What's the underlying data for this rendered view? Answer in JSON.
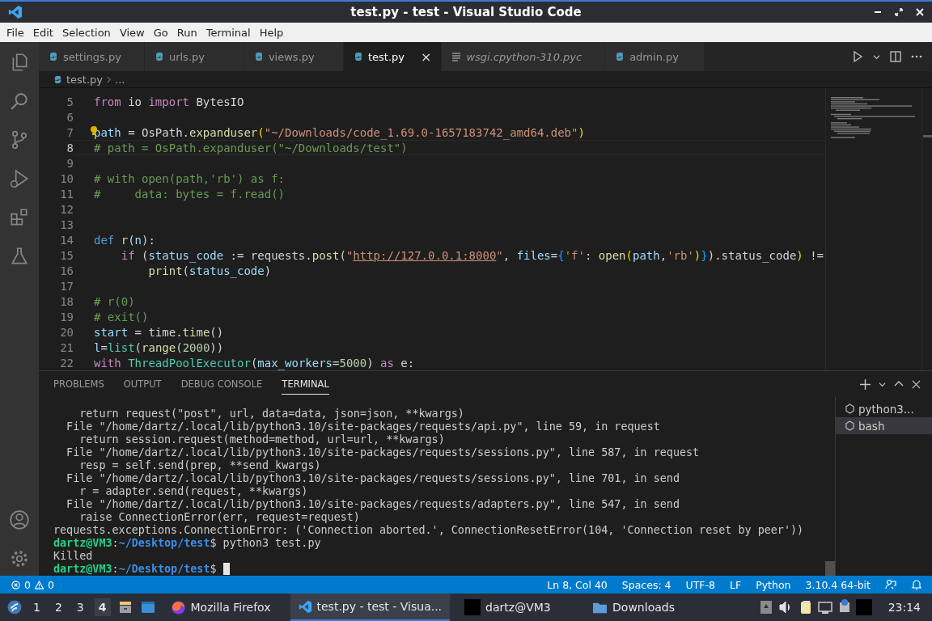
{
  "window": {
    "title": "test.py - test - Visual Studio Code"
  },
  "menu": [
    "File",
    "Edit",
    "Selection",
    "View",
    "Go",
    "Run",
    "Terminal",
    "Help"
  ],
  "tabs": [
    {
      "label": "settings.py",
      "kind": "python",
      "selected": false,
      "preview": false
    },
    {
      "label": "urls.py",
      "kind": "python",
      "selected": false,
      "preview": false
    },
    {
      "label": "views.py",
      "kind": "python",
      "selected": false,
      "preview": false
    },
    {
      "label": "test.py",
      "kind": "python",
      "selected": true,
      "preview": false,
      "close": "×"
    },
    {
      "label": "wsgi.cpython-310.pyc",
      "kind": "binary",
      "selected": false,
      "preview": true
    },
    {
      "label": "admin.py",
      "kind": "python",
      "selected": false,
      "preview": false
    }
  ],
  "breadcrumb": {
    "file": "test.py",
    "rest": "..."
  },
  "code": [
    {
      "number": "5",
      "current": false,
      "tokens": [
        {
          "kind": "kw",
          "text": "from"
        },
        {
          "kind": "plain",
          "text": " io "
        },
        {
          "kind": "kw",
          "text": "import"
        },
        {
          "kind": "plain",
          "text": " BytesIO"
        }
      ]
    },
    {
      "number": "6",
      "current": false
    },
    {
      "number": "7",
      "current": false,
      "bulb": true,
      "tokens": [
        {
          "kind": "var",
          "text": "path"
        },
        {
          "kind": "plain",
          "text": " = OsPath."
        },
        {
          "kind": "fn",
          "text": "expanduser"
        },
        {
          "kind": "brace",
          "text": "("
        },
        {
          "kind": "str",
          "text": "\"~/Downloads/code_1.69.0-1657183742_amd64.deb\""
        },
        {
          "kind": "brace",
          "text": ")"
        }
      ]
    },
    {
      "number": "8",
      "current": true,
      "tokens": [
        {
          "kind": "com",
          "text": "# path = OsPath.expanduser(\"~/Downloads/test\")"
        }
      ]
    },
    {
      "number": "9",
      "current": false
    },
    {
      "number": "10",
      "current": false,
      "tokens": [
        {
          "kind": "com",
          "text": "# with open(path,'rb') as f:"
        }
      ]
    },
    {
      "number": "11",
      "current": false,
      "tokens": [
        {
          "kind": "com",
          "text": "#     data: bytes = f.read()"
        }
      ]
    },
    {
      "number": "12",
      "current": false
    },
    {
      "number": "13",
      "current": false
    },
    {
      "number": "14",
      "current": false,
      "tokens": [
        {
          "kind": "def",
          "text": "def "
        },
        {
          "kind": "fn",
          "text": "r"
        },
        {
          "kind": "plain",
          "text": "("
        },
        {
          "kind": "var",
          "text": "n"
        },
        {
          "kind": "plain",
          "text": "):"
        }
      ]
    },
    {
      "number": "15",
      "current": false,
      "tokens": [
        {
          "kind": "kw",
          "text": "    if"
        },
        {
          "kind": "plain",
          "text": " ("
        },
        {
          "kind": "var",
          "text": "status_code"
        },
        {
          "kind": "plain",
          "text": " := requests."
        },
        {
          "kind": "fn",
          "text": "post"
        },
        {
          "kind": "plain",
          "text": "("
        },
        {
          "kind": "str",
          "text": "\""
        },
        {
          "kind": "link",
          "text": "http://127.0.0.1:8000"
        },
        {
          "kind": "str",
          "text": "\""
        },
        {
          "kind": "plain",
          "text": ", "
        },
        {
          "kind": "var",
          "text": "files"
        },
        {
          "kind": "plain",
          "text": "="
        },
        {
          "kind": "brace2",
          "text": "{"
        },
        {
          "kind": "str",
          "text": "'f'"
        },
        {
          "kind": "plain",
          "text": ": "
        },
        {
          "kind": "fn",
          "text": "open"
        },
        {
          "kind": "brace",
          "text": "("
        },
        {
          "kind": "var",
          "text": "path"
        },
        {
          "kind": "plain",
          "text": ","
        },
        {
          "kind": "str",
          "text": "'rb'"
        },
        {
          "kind": "brace",
          "text": ")"
        },
        {
          "kind": "brace2",
          "text": "}"
        },
        {
          "kind": "plain",
          "text": ").status_code"
        },
        {
          "kind": "brace",
          "text": ")"
        },
        {
          "kind": "plain",
          "text": " !="
        }
      ]
    },
    {
      "number": "16",
      "current": false,
      "tokens": [
        {
          "kind": "fn",
          "text": "        print"
        },
        {
          "kind": "plain",
          "text": "("
        },
        {
          "kind": "var",
          "text": "status_code"
        },
        {
          "kind": "plain",
          "text": ")"
        }
      ]
    },
    {
      "number": "17",
      "current": false
    },
    {
      "number": "18",
      "current": false,
      "tokens": [
        {
          "kind": "com",
          "text": "# r(0)"
        }
      ]
    },
    {
      "number": "19",
      "current": false,
      "tokens": [
        {
          "kind": "com",
          "text": "# exit()"
        }
      ]
    },
    {
      "number": "20",
      "current": false,
      "tokens": [
        {
          "kind": "var",
          "text": "start"
        },
        {
          "kind": "plain",
          "text": " = time."
        },
        {
          "kind": "fn",
          "text": "time"
        },
        {
          "kind": "plain",
          "text": "()"
        }
      ]
    },
    {
      "number": "21",
      "current": false,
      "tokens": [
        {
          "kind": "var",
          "text": "l"
        },
        {
          "kind": "plain",
          "text": "="
        },
        {
          "kind": "cls",
          "text": "list"
        },
        {
          "kind": "plain",
          "text": "("
        },
        {
          "kind": "fn",
          "text": "range"
        },
        {
          "kind": "plain",
          "text": "("
        },
        {
          "kind": "num",
          "text": "2000"
        },
        {
          "kind": "plain",
          "text": "))"
        }
      ]
    },
    {
      "number": "22",
      "current": false,
      "tokens": [
        {
          "kind": "kw",
          "text": "with "
        },
        {
          "kind": "cls",
          "text": "ThreadPoolExecutor"
        },
        {
          "kind": "plain",
          "text": "("
        },
        {
          "kind": "var",
          "text": "max_workers"
        },
        {
          "kind": "plain",
          "text": "="
        },
        {
          "kind": "num",
          "text": "5000"
        },
        {
          "kind": "plain",
          "text": ") "
        },
        {
          "kind": "kw",
          "text": "as"
        },
        {
          "kind": "plain",
          "text": " e:"
        }
      ]
    }
  ],
  "panel_tabs": [
    {
      "label": "PROBLEMS",
      "selected": false
    },
    {
      "label": "OUTPUT",
      "selected": false
    },
    {
      "label": "DEBUG CONSOLE",
      "selected": false
    },
    {
      "label": "TERMINAL",
      "selected": true
    }
  ],
  "terminal": [
    {
      "kind": "plain",
      "text": "    return request(\"post\", url, data=data, json=json, **kwargs)"
    },
    {
      "kind": "plain",
      "text": "  File \"/home/dartz/.local/lib/python3.10/site-packages/requests/api.py\", line 59, in request"
    },
    {
      "kind": "plain",
      "text": "    return session.request(method=method, url=url, **kwargs)"
    },
    {
      "kind": "plain",
      "text": "  File \"/home/dartz/.local/lib/python3.10/site-packages/requests/sessions.py\", line 587, in request"
    },
    {
      "kind": "plain",
      "text": "    resp = self.send(prep, **send_kwargs)"
    },
    {
      "kind": "plain",
      "text": "  File \"/home/dartz/.local/lib/python3.10/site-packages/requests/sessions.py\", line 701, in send"
    },
    {
      "kind": "plain",
      "text": "    r = adapter.send(request, **kwargs)"
    },
    {
      "kind": "plain",
      "text": "  File \"/home/dartz/.local/lib/python3.10/site-packages/requests/adapters.py\", line 547, in send"
    },
    {
      "kind": "plain",
      "text": "    raise ConnectionError(err, request=request)"
    },
    {
      "kind": "plain",
      "text": "requests.exceptions.ConnectionError: ('Connection aborted.', ConnectionResetError(104, 'Connection reset by peer'))"
    },
    {
      "kind": "prompt",
      "user": "dartz@VM3",
      "sep": ":",
      "path": "~/Desktop/test",
      "command": "$ python3 test.py"
    },
    {
      "kind": "plain",
      "text": "Killed"
    },
    {
      "kind": "prompt",
      "user": "dartz@VM3",
      "sep": ":",
      "path": "~/Desktop/test",
      "command": "$ ",
      "cursor": true
    }
  ],
  "terminal_list": [
    {
      "label": "python3...",
      "selected": false
    },
    {
      "label": "bash",
      "selected": true
    }
  ],
  "status_bar": {
    "errors": "0",
    "warnings": "0",
    "items": [
      "Ln 8, Col 40",
      "Spaces: 4",
      "UTF-8",
      "LF",
      "Python",
      "3.10.4 64-bit"
    ]
  },
  "taskbar": {
    "workspaces": [
      {
        "label": "1",
        "selected": false
      },
      {
        "label": "2",
        "selected": false
      },
      {
        "label": "3",
        "selected": false
      },
      {
        "label": "4",
        "selected": true
      }
    ],
    "windows": [
      {
        "label": "Mozilla Firefox",
        "kind": "browser",
        "selected": false
      },
      {
        "label": "test.py - test - Visua...",
        "kind": "editor",
        "selected": true
      },
      {
        "label": "dartz@VM3",
        "kind": "terminal",
        "selected": false
      },
      {
        "label": "Downloads",
        "kind": "folder",
        "selected": false
      }
    ],
    "clock": "23:14"
  }
}
